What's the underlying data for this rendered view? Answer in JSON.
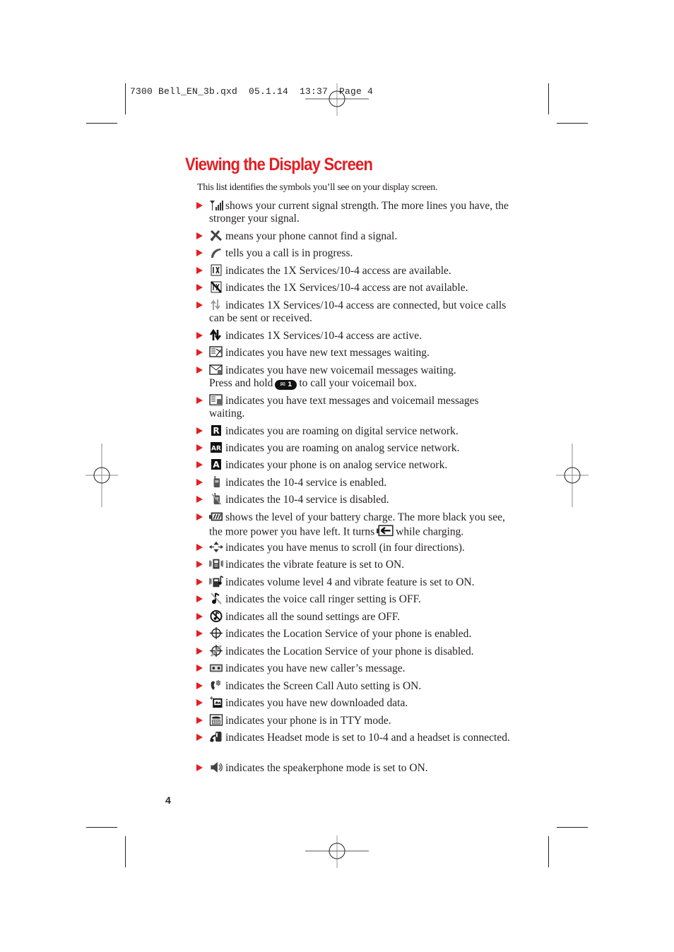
{
  "slug": "7300 Bell_EN_3b.qxd  05.1.14  13:37  Page 4",
  "title": "Viewing the Display Screen",
  "intro": "This list identifies the symbols you’ll see on your display screen.",
  "accent_color": "#e31e24",
  "items": [
    {
      "icon": "signal-strength-icon",
      "before": "",
      "text": "shows your current signal strength. The more lines you have, the stronger your signal."
    },
    {
      "icon": "no-signal-icon",
      "text": "means your phone cannot find a signal."
    },
    {
      "icon": "call-in-progress-icon",
      "text": "tells you a call is in progress."
    },
    {
      "icon": "1x-available-icon",
      "text": "indicates the 1X Services/10-4 access are available."
    },
    {
      "icon": "1x-not-available-icon",
      "text": "indicates the 1X Services/10-4 access are not available."
    },
    {
      "icon": "1x-connected-icon",
      "text": "indicates 1X Services/10-4 access are connected, but voice calls can be sent or received."
    },
    {
      "icon": "1x-active-icon",
      "text": "indicates 1X Services/10-4 access are active."
    },
    {
      "icon": "text-message-icon",
      "text": "indicates you have new text messages waiting."
    },
    {
      "icon": "voicemail-icon",
      "text": "indicates you have new voicemail messages waiting.",
      "line2_before": "Press and hold",
      "key_icon": "voicemail-key-icon",
      "key_label": "✉ 1",
      "line2_after": "to call your voicemail box."
    },
    {
      "icon": "text-and-voicemail-icon",
      "text": "indicates you have text messages and voicemail messages waiting."
    },
    {
      "icon": "roaming-digital-icon",
      "text": "indicates you are roaming on digital service network."
    },
    {
      "icon": "roaming-analog-icon",
      "text": "indicates you are roaming on analog service network."
    },
    {
      "icon": "analog-network-icon",
      "text": "indicates your phone is on analog service network."
    },
    {
      "icon": "10-4-enabled-icon",
      "text": "indicates the 10-4 service is enabled."
    },
    {
      "icon": "10-4-disabled-icon",
      "text": "indicates the 10-4 service is disabled."
    },
    {
      "icon": "battery-level-icon",
      "text": "shows the level of your battery charge. The more black you see, the more power you have left. It turns",
      "inline_icon": "battery-charging-icon",
      "text_after": "while charging."
    },
    {
      "icon": "four-way-scroll-icon",
      "text": "indicates you have menus to scroll (in four directions)."
    },
    {
      "icon": "vibrate-icon",
      "text": "indicates the vibrate feature is set to ON."
    },
    {
      "icon": "volume4-vibrate-icon",
      "text": "indicates volume level 4 and vibrate feature is set to ON."
    },
    {
      "icon": "ringer-off-icon",
      "text": "indicates the voice call ringer setting is OFF."
    },
    {
      "icon": "all-sound-off-icon",
      "text": "indicates all the sound settings are OFF."
    },
    {
      "icon": "location-on-icon",
      "text": "indicates the Location Service of your phone is enabled."
    },
    {
      "icon": "location-off-icon",
      "text": "indicates the Location Service of your phone is disabled."
    },
    {
      "icon": "caller-message-icon",
      "text": "indicates you have new caller’s message."
    },
    {
      "icon": "screen-call-auto-icon",
      "text": "indicates the Screen Call Auto setting is ON."
    },
    {
      "icon": "downloaded-data-icon",
      "text": "indicates you have new downloaded data."
    },
    {
      "icon": "tty-mode-icon",
      "text": "indicates your phone is in TTY mode."
    },
    {
      "icon": "headset-10-4-icon",
      "text": "indicates Headset mode is set to 10-4 and a headset is connected."
    },
    {
      "icon": "speakerphone-icon",
      "text": "indicates the speakerphone mode is set to ON."
    }
  ],
  "page_number": "4"
}
